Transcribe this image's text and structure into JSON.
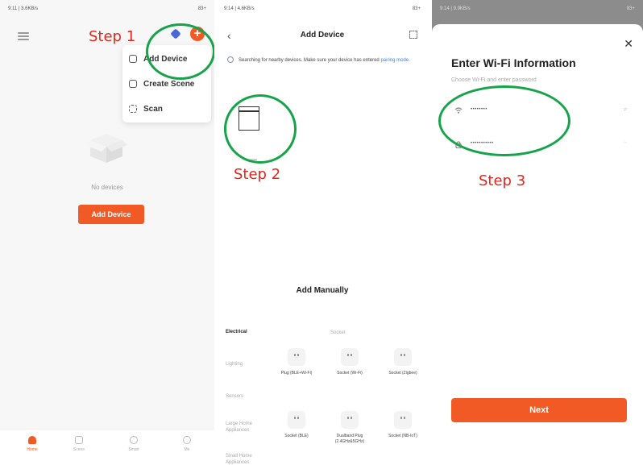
{
  "steps": {
    "step1": "Step 1",
    "step2": "Step 2",
    "step3": "Step 3"
  },
  "colors": {
    "accent": "#f15a24",
    "annotation_circle": "#16a34a",
    "annotation_text": "#e0271f"
  },
  "home": {
    "status_left": "9:11 | 3.6KB/s",
    "status_right": "83+",
    "menu": {
      "add_device": "Add Device",
      "create_scene": "Create Scene",
      "scan": "Scan"
    },
    "empty_text": "No devices",
    "add_button": "Add Device",
    "tabs": [
      {
        "label": "Home",
        "icon": "home-icon"
      },
      {
        "label": "Scene",
        "icon": "scene-icon"
      },
      {
        "label": "Smart",
        "icon": "smart-icon"
      },
      {
        "label": "Me",
        "icon": "me-icon"
      }
    ]
  },
  "add_device": {
    "status_left": "9:14 | 4.6KB/s",
    "status_right": "83+",
    "title": "Add Device",
    "searching_text": "Searching for nearby devices. Make sure your device has entered",
    "pairing_link": "pairing mode.",
    "manual_title": "Add Manually",
    "categories": [
      "Electrical",
      "Lighting",
      "Sensors",
      "Large Home Appliances",
      "Small Home Appliances"
    ],
    "sub_header": "Socket",
    "devices": [
      {
        "label": "Plug (BLE+Wi-Fi)"
      },
      {
        "label": "Socket (Wi-Fi)"
      },
      {
        "label": "Socket (Zigbee)"
      },
      {
        "label": "Socket (BLE)"
      },
      {
        "label": "Dualband Plug (2.4GHz&5GHz)"
      },
      {
        "label": "Socket (NB-IoT)"
      }
    ]
  },
  "wifi": {
    "status_left": "9:14 | 9.9KB/s",
    "status_right": "83+",
    "title": "Enter Wi-Fi Information",
    "subtitle": "Choose Wi-Fi and enter password",
    "network_value": "••••••••",
    "password_value": "•••••••••••",
    "next_button": "Next"
  }
}
